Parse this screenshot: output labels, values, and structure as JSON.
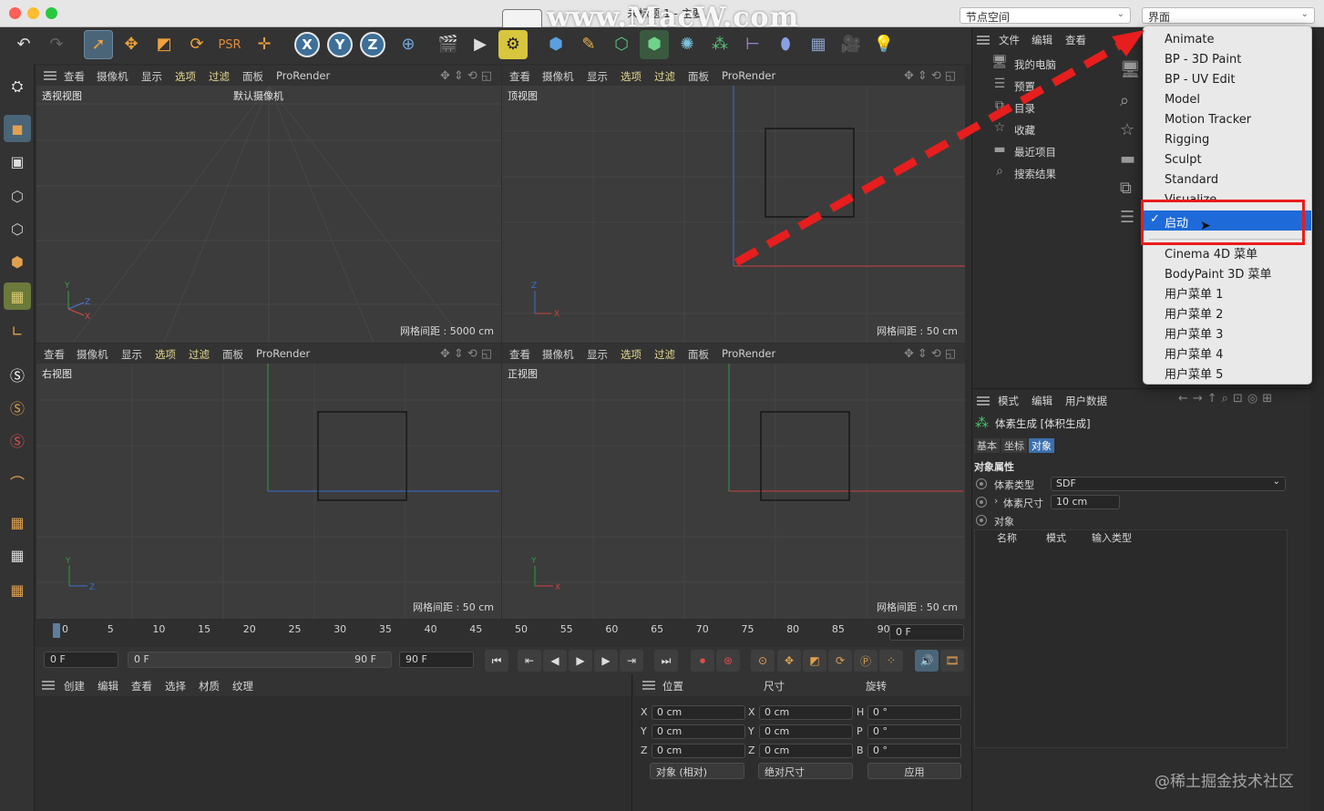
{
  "window": {
    "title": "未标题 1 - 主要",
    "watermark": "www.MacW.com",
    "node_space_dropdown": "节点空间",
    "layout_dropdown": "界面"
  },
  "toolbar_icons": [
    "undo-icon",
    "redo-icon",
    "select-arrow-icon",
    "move-icon",
    "scale-icon",
    "rotate-icon",
    "coordinate-system-icon",
    "world-axis-icon",
    "x-axis-lock",
    "y-axis-lock",
    "z-axis-lock",
    "coordinate-system-toggle",
    "render-region-icon",
    "render-view-icon",
    "render-settings-icon",
    "cube-primitive-icon",
    "pen-spline-icon",
    "subdivision-icon",
    "volume-icon",
    "array-icon",
    "mograph-icon",
    "deformer-icon",
    "sweep-icon",
    "floor-icon",
    "camera-icon",
    "light-icon"
  ],
  "axis_labels": {
    "x": "X",
    "y": "Y",
    "z": "Z"
  },
  "viewport_menu": [
    "查看",
    "摄像机",
    "显示",
    "选项",
    "过滤",
    "面板",
    "ProRender"
  ],
  "viewports": {
    "perspective": {
      "label": "透视视图",
      "camera": "默认摄像机",
      "grid": "网格间距 : 5000 cm"
    },
    "top": {
      "label": "顶视图",
      "grid": "网格间距 : 50 cm"
    },
    "right": {
      "label": "右视图",
      "grid": "网格间距 : 50 cm"
    },
    "front": {
      "label": "正视图",
      "grid": "网格间距 : 50 cm"
    }
  },
  "timeline": {
    "ticks": [
      "0",
      "5",
      "10",
      "15",
      "20",
      "25",
      "30",
      "35",
      "40",
      "45",
      "50",
      "55",
      "60",
      "65",
      "70",
      "75",
      "80",
      "85",
      "90"
    ],
    "current_frame": "0 F",
    "start_field": "0 F",
    "range_start": "0 F",
    "range_end": "90 F",
    "end_field": "90 F"
  },
  "material_panel": {
    "menu": [
      "创建",
      "编辑",
      "查看",
      "选择",
      "材质",
      "纹理"
    ]
  },
  "coordinates": {
    "headers": {
      "position": "位置",
      "size": "尺寸",
      "rotation": "旋转"
    },
    "rows": [
      {
        "pos_axis": "X",
        "pos": "0 cm",
        "size_axis": "X",
        "size": "0 cm",
        "rot_axis": "H",
        "rot": "0 °"
      },
      {
        "pos_axis": "Y",
        "pos": "0 cm",
        "size_axis": "Y",
        "size": "0 cm",
        "rot_axis": "P",
        "rot": "0 °"
      },
      {
        "pos_axis": "Z",
        "pos": "0 cm",
        "size_axis": "Z",
        "size": "0 cm",
        "rot_axis": "B",
        "rot": "0 °"
      }
    ],
    "mode_select": "对象 (相对)",
    "size_select": "绝对尺寸",
    "apply_button": "应用"
  },
  "object_panel": {
    "menu": [
      "文件",
      "编辑",
      "查看"
    ],
    "tree": [
      "我的电脑",
      "预置",
      "目录",
      "收藏",
      "最近项目",
      "搜索结果"
    ]
  },
  "attributes": {
    "menu": [
      "模式",
      "编辑",
      "用户数据"
    ],
    "object_name": "体素生成 [体积生成]",
    "tabs": [
      "基本",
      "坐标",
      "对象"
    ],
    "section": "对象属性",
    "voxel_type_label": "体素类型",
    "voxel_type_value": "SDF",
    "voxel_size_label": "体素尺寸",
    "voxel_size_value": "10 cm",
    "objects_label": "对象",
    "table_headers": [
      "名称",
      "模式",
      "输入类型"
    ]
  },
  "layout_menu": {
    "items": [
      "Animate",
      "BP - 3D Paint",
      "BP - UV Edit",
      "Model",
      "Motion Tracker",
      "Rigging",
      "Sculpt",
      "Standard",
      "Visualize"
    ],
    "selected": "启动",
    "items2": [
      "Cinema 4D 菜单",
      "BodyPaint 3D 菜单",
      "用户菜单 1",
      "用户菜单 2",
      "用户菜单 3",
      "用户菜单 4",
      "用户菜单 5"
    ]
  },
  "corner_watermark": "@稀土掘金技术社区",
  "colors": {
    "accent": "#1e6ad8",
    "annotation": "#ea1c1c",
    "active_tab": "#3b6fae"
  }
}
